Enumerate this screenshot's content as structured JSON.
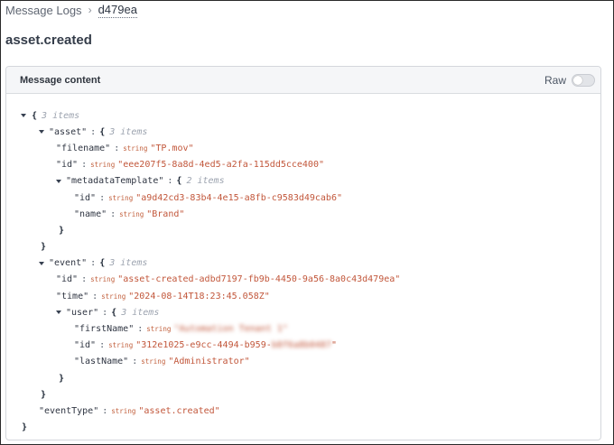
{
  "breadcrumb": {
    "parent": "Message Logs",
    "separator": "›",
    "current": "d479ea"
  },
  "page_title": "asset.created",
  "panel": {
    "title": "Message content",
    "raw_label": "Raw",
    "raw_on": false
  },
  "json_view": {
    "items_suffix": "items",
    "root": {
      "count": "3"
    },
    "asset": {
      "key": "\"asset\"",
      "count": "3",
      "filename": {
        "key": "\"filename\"",
        "type": "string",
        "value": "\"TP.mov\""
      },
      "id": {
        "key": "\"id\"",
        "type": "string",
        "value": "\"eee207f5-8a8d-4ed5-a2fa-115dd5cce400\""
      },
      "metadataTemplate": {
        "key": "\"metadataTemplate\"",
        "count": "2",
        "id": {
          "key": "\"id\"",
          "type": "string",
          "value": "\"a9d42cd3-83b4-4e15-a8fb-c9583d49cab6\""
        },
        "name": {
          "key": "\"name\"",
          "type": "string",
          "value": "\"Brand\""
        }
      }
    },
    "event": {
      "key": "\"event\"",
      "count": "3",
      "id": {
        "key": "\"id\"",
        "type": "string",
        "value": "\"asset-created-adbd7197-fb9b-4450-9a56-8a0c43d479ea\""
      },
      "time": {
        "key": "\"time\"",
        "type": "string",
        "value": "\"2024-08-14T18:23:45.058Z\""
      },
      "user": {
        "key": "\"user\"",
        "count": "3",
        "firstName": {
          "key": "\"firstName\"",
          "type": "string",
          "value": "\"Automation Tenant 1\""
        },
        "id": {
          "key": "\"id\"",
          "type": "string",
          "value_visible": "\"312e1025-e9cc-4494-b959-",
          "value_blurred": "b8f6a8b0487",
          "value_end": "\""
        },
        "lastName": {
          "key": "\"lastName\"",
          "type": "string",
          "value": "\"Administrator\""
        }
      }
    },
    "eventType": {
      "key": "\"eventType\"",
      "type": "string",
      "value": "\"asset.created\""
    }
  }
}
